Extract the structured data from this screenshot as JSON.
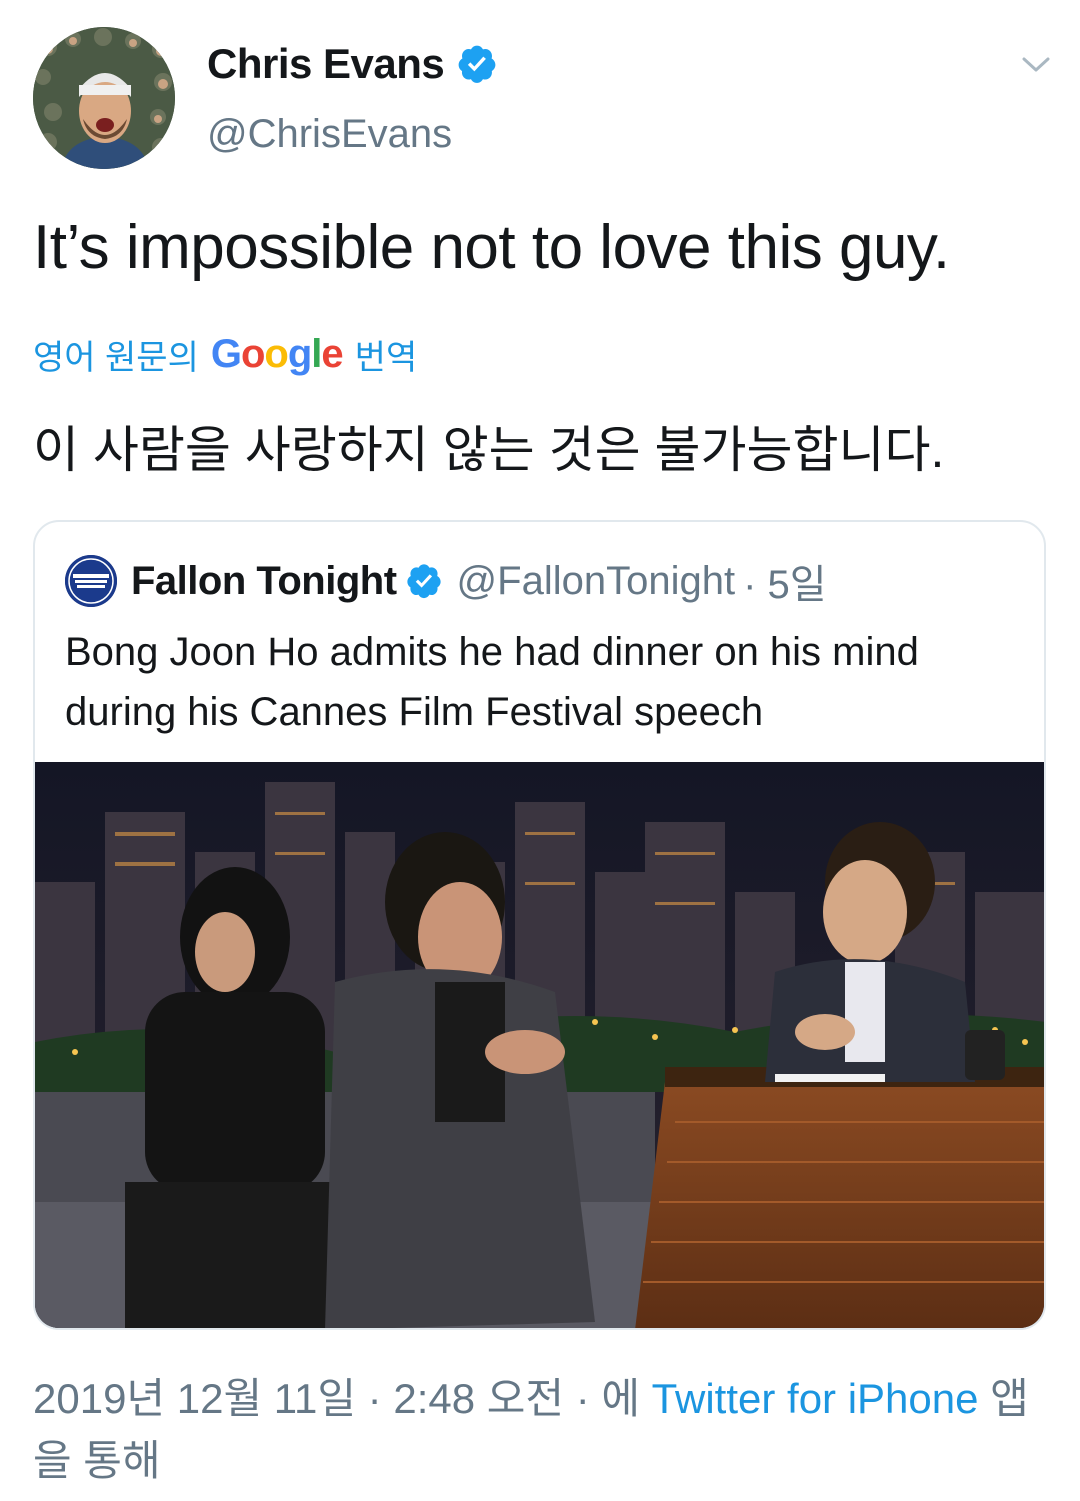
{
  "author": {
    "name": "Chris Evans",
    "handle": "@ChrisEvans"
  },
  "tweet": {
    "text": "It’s impossible not to love this guy."
  },
  "translation": {
    "prefix": "영어 원문의",
    "google": "Google",
    "suffix": "번역",
    "text": "이 사람을 사랑하지 않는 것은 불가능합니다."
  },
  "quoted": {
    "name": "Fallon Tonight",
    "handle": "@FallonTonight",
    "time": "· 5일",
    "text": "Bong Joon Ho admits he had dinner on his mind during his Cannes Film Festival speech",
    "logo_text": "THE TONIGHT SHOW JIMMY FALLON"
  },
  "footer": {
    "datetime": "2019년 12월 11일 · 2:48 오전 · 에",
    "source": "Twitter for iPhone",
    "suffix": "앱을 통해"
  },
  "colors": {
    "link": "#1b95e0",
    "secondary": "#657786",
    "verified": "#1da1f2"
  },
  "icons": [
    "verified-badge-icon",
    "chevron-down-icon"
  ]
}
